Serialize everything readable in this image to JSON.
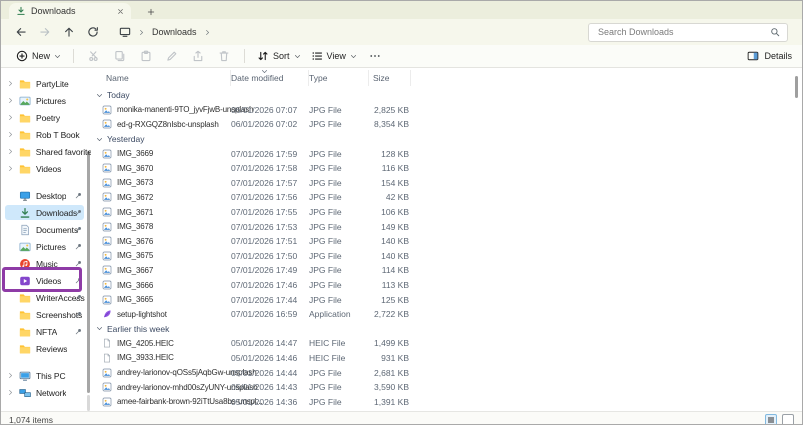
{
  "tabbar": {
    "tab_title": "Downloads"
  },
  "nav": {
    "breadcrumb_item": "Downloads",
    "search_placeholder": "Search Downloads"
  },
  "toolbar": {
    "new_label": "New",
    "sort_label": "Sort",
    "view_label": "View",
    "details_label": "Details"
  },
  "sidebar": {
    "tree": [
      {
        "label": "PartyLite",
        "icon": "folder",
        "chevron": true
      },
      {
        "label": "Pictures",
        "icon": "pictures",
        "chevron": true
      },
      {
        "label": "Poetry",
        "icon": "folder",
        "chevron": true
      },
      {
        "label": "Rob T Book",
        "icon": "folder",
        "chevron": true
      },
      {
        "label": "Shared favorite",
        "icon": "folder",
        "chevron": true
      },
      {
        "label": "Videos",
        "icon": "folder",
        "chevron": true
      }
    ],
    "pinned": [
      {
        "label": "Desktop",
        "icon": "desktop",
        "pin": true
      },
      {
        "label": "Downloads",
        "icon": "download",
        "pin": true,
        "selected": true
      },
      {
        "label": "Documents",
        "icon": "document",
        "pin": true
      },
      {
        "label": "Pictures",
        "icon": "pictures",
        "pin": true
      },
      {
        "label": "Music",
        "icon": "music",
        "pin": true
      },
      {
        "label": "Videos",
        "icon": "videos",
        "pin": true
      },
      {
        "label": "WriterAccess",
        "icon": "folder",
        "pin": true
      },
      {
        "label": "Screenshots",
        "icon": "folder",
        "pin": true
      },
      {
        "label": "NFTA",
        "icon": "folder",
        "pin": true
      },
      {
        "label": "Reviews",
        "icon": "folder",
        "pin": false
      }
    ],
    "system": [
      {
        "label": "This PC",
        "icon": "pc",
        "chevron": true
      },
      {
        "label": "Network",
        "icon": "network",
        "chevron": true
      }
    ]
  },
  "filelist": {
    "columns": [
      "Name",
      "Date modified",
      "Type",
      "Size"
    ],
    "groups": [
      {
        "label": "Today",
        "files": [
          {
            "name": "monika-manenti-9TO_jyvFjwB-unsplash",
            "date": "06/01/2026 07:07",
            "type": "JPG File",
            "size": "2,825 KB",
            "icon": "jpg"
          },
          {
            "name": "ed-g-RXGQZ8nIsbc-unsplash",
            "date": "06/01/2026 07:02",
            "type": "JPG File",
            "size": "8,354 KB",
            "icon": "jpg"
          }
        ]
      },
      {
        "label": "Yesterday",
        "files": [
          {
            "name": "IMG_3669",
            "date": "07/01/2026 17:59",
            "type": "JPG File",
            "size": "128 KB",
            "icon": "jpg"
          },
          {
            "name": "IMG_3670",
            "date": "07/01/2026 17:58",
            "type": "JPG File",
            "size": "116 KB",
            "icon": "jpg"
          },
          {
            "name": "IMG_3673",
            "date": "07/01/2026 17:57",
            "type": "JPG File",
            "size": "154 KB",
            "icon": "jpg"
          },
          {
            "name": "IMG_3672",
            "date": "07/01/2026 17:56",
            "type": "JPG File",
            "size": "42 KB",
            "icon": "jpg"
          },
          {
            "name": "IMG_3671",
            "date": "07/01/2026 17:55",
            "type": "JPG File",
            "size": "106 KB",
            "icon": "jpg"
          },
          {
            "name": "IMG_3678",
            "date": "07/01/2026 17:53",
            "type": "JPG File",
            "size": "149 KB",
            "icon": "jpg"
          },
          {
            "name": "IMG_3676",
            "date": "07/01/2026 17:51",
            "type": "JPG File",
            "size": "140 KB",
            "icon": "jpg"
          },
          {
            "name": "IMG_3675",
            "date": "07/01/2026 17:50",
            "type": "JPG File",
            "size": "140 KB",
            "icon": "jpg"
          },
          {
            "name": "IMG_3667",
            "date": "07/01/2026 17:49",
            "type": "JPG File",
            "size": "114 KB",
            "icon": "jpg"
          },
          {
            "name": "IMG_3666",
            "date": "07/01/2026 17:46",
            "type": "JPG File",
            "size": "113 KB",
            "icon": "jpg"
          },
          {
            "name": "IMG_3665",
            "date": "07/01/2026 17:44",
            "type": "JPG File",
            "size": "125 KB",
            "icon": "jpg"
          },
          {
            "name": "setup-lightshot",
            "date": "07/01/2026 16:59",
            "type": "Application",
            "size": "2,722 KB",
            "icon": "app"
          }
        ]
      },
      {
        "label": "Earlier this week",
        "files": [
          {
            "name": "IMG_4205.HEIC",
            "date": "05/01/2026 14:47",
            "type": "HEIC File",
            "size": "1,499 KB",
            "icon": "heic"
          },
          {
            "name": "IMG_3933.HEIC",
            "date": "05/01/2026 14:46",
            "type": "HEIC File",
            "size": "931 KB",
            "icon": "heic"
          },
          {
            "name": "andrey-larionov-qOSs5jAqbGw-unsplash",
            "date": "05/01/2026 14:44",
            "type": "JPG File",
            "size": "2,681 KB",
            "icon": "jpg"
          },
          {
            "name": "andrey-larionov-mhd00sZyUNY-unsplash",
            "date": "05/01/2026 14:43",
            "type": "JPG File",
            "size": "3,590 KB",
            "icon": "jpg"
          },
          {
            "name": "amee-fairbank-brown-92iTtUsa8bs-unspl...",
            "date": "05/01/2026 14:36",
            "type": "JPG File",
            "size": "1,391 KB",
            "icon": "jpg"
          }
        ]
      }
    ]
  },
  "statusbar": {
    "count": "1,074 items"
  },
  "colors": {
    "annotation": "#8e3ba6",
    "selection": "#cfe8fb"
  }
}
